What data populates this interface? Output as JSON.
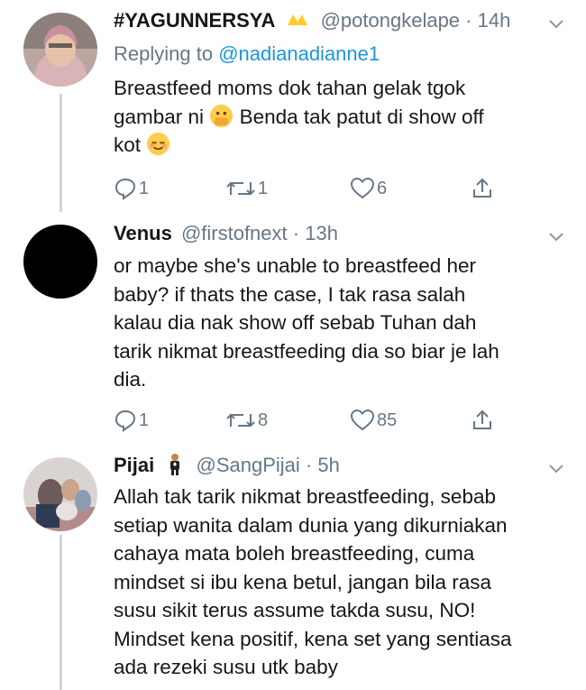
{
  "tweets": [
    {
      "name": "#YAGUNNERSYA",
      "handle": "@potongkelape",
      "dot": "·",
      "time": "14h",
      "replying_prefix": "Replying to ",
      "replying_to": "@nadianadianne1",
      "text_part1": "Breastfeed moms dok tahan gelak tgok\ngambar ni ",
      "text_part2": " Benda tak patut di show off\nkot ",
      "reply_count": "1",
      "retweet_count": "1",
      "like_count": "6",
      "icons": [
        "shushing-face-emoji",
        "relieved-face-emoji"
      ]
    },
    {
      "name": "Venus",
      "handle": "@firstofnext",
      "dot": "·",
      "time": "13h",
      "text": "or maybe she's unable to breastfeed her\nbaby? if thats the case, I tak rasa salah\nkalau dia nak show off sebab Tuhan dah\ntarik nikmat breastfeeding dia so biar je lah\ndia.",
      "reply_count": "1",
      "retweet_count": "8",
      "like_count": "85"
    },
    {
      "name": "Pijai",
      "handle": "@SangPijai",
      "dot": "·",
      "time": "5h",
      "text": "Allah tak tarik nikmat breastfeeding, sebab\nsetiap wanita dalam dunia yang dikurniakan\ncahaya mata boleh breastfeeding, cuma\nmindset si ibu kena betul, jangan bila rasa\nsusu sikit terus assume takda susu, NO!\nMindset kena positif, kena set yang sentiasa\nada rezeki  susu utk baby",
      "icons": [
        "man-in-tuxedo-emoji"
      ]
    }
  ],
  "colors": {
    "text": "#14171a",
    "muted": "#657786",
    "link": "#1b95e0",
    "thread_line": "#ccd6dd",
    "emoji_yellow": "#ffcc4d"
  }
}
